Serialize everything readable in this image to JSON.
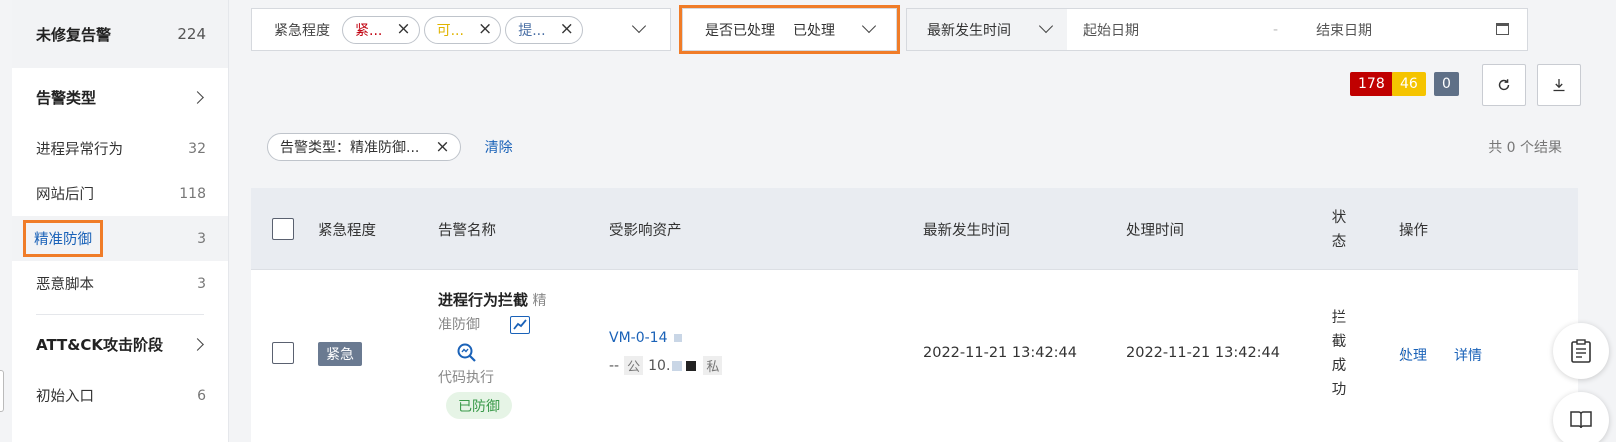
{
  "sidebar": {
    "header": {
      "title": "未修复告警",
      "count": "224"
    },
    "alert_type_group": "告警类型",
    "items": [
      {
        "label": "进程异常行为",
        "count": "32"
      },
      {
        "label": "网站后门",
        "count": "118"
      },
      {
        "label": "精准防御",
        "count": "3"
      },
      {
        "label": "恶意脚本",
        "count": "3"
      }
    ],
    "attck_group": "ATT&CK攻击阶段",
    "attck_items": [
      {
        "label": "初始入口",
        "count": "6"
      }
    ]
  },
  "filters": {
    "urgency_label": "紧急程度",
    "urgency_tags": [
      "紧...",
      "可...",
      "提..."
    ],
    "processed_label": "是否已处理",
    "processed_value": "已处理",
    "time_select": "最新发生时间",
    "start_placeholder": "起始日期",
    "range_separator": "-",
    "end_placeholder": "结束日期"
  },
  "counts": {
    "red": "178",
    "yellow": "46",
    "gray": "0"
  },
  "result_bar": {
    "chip": "告警类型：精准防御...",
    "clear": "清除",
    "total": "共 0 个结果"
  },
  "table": {
    "headers": {
      "urgency": "紧急程度",
      "name": "告警名称",
      "asset": "受影响资产",
      "latest_time": "最新发生时间",
      "handled_time": "处理时间",
      "status_1": "状",
      "status_2": "态",
      "action": "操作"
    },
    "row": {
      "urgency": "紧急",
      "name_bold": "进程行为拦截",
      "name_gray_1": "精",
      "name_gray_2": "准防御",
      "sub": "代码执行",
      "defended": "已防御",
      "asset_name": "VM-0-14",
      "asset_dash": "--",
      "asset_public": "公",
      "asset_ip": "10.",
      "asset_private": "私",
      "latest_time": "2022-11-21 13:42:44",
      "handled_time": "2022-11-21 13:42:44",
      "status_chars": [
        "拦",
        "截",
        "成",
        "功"
      ],
      "action_handle": "处理",
      "action_detail": "详情"
    }
  },
  "colors": {
    "accent": "#1a62b8",
    "highlight": "#f07c28",
    "red": "#c00000",
    "yellow": "#f5c400",
    "gray": "#5f7087"
  }
}
